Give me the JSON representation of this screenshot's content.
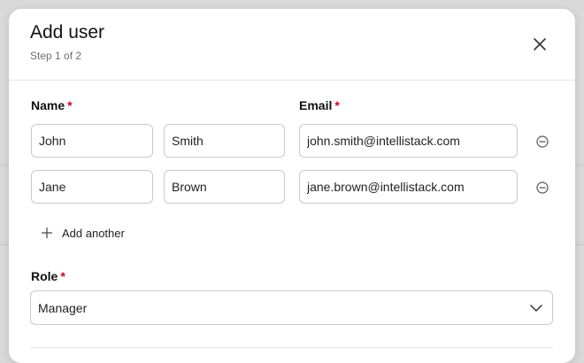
{
  "dialog": {
    "title": "Add user",
    "step": "Step 1 of 2"
  },
  "labels": {
    "name": "Name",
    "email": "Email",
    "role": "Role",
    "required_mark": "*"
  },
  "users": [
    {
      "first_name": "John",
      "last_name": "Smith",
      "email": "john.smith@intellistack.com"
    },
    {
      "first_name": "Jane",
      "last_name": "Brown",
      "email": "jane.brown@intellistack.com"
    }
  ],
  "add_another_label": "Add another",
  "role": {
    "selected": "Manager"
  },
  "icons": {
    "close": "close-icon",
    "remove": "minus-circle-icon",
    "add": "plus-icon",
    "dropdown": "chevron-down-icon"
  },
  "colors": {
    "required": "#d0021b",
    "border": "#c9c9c9",
    "backdrop": "#d9d9d9"
  }
}
